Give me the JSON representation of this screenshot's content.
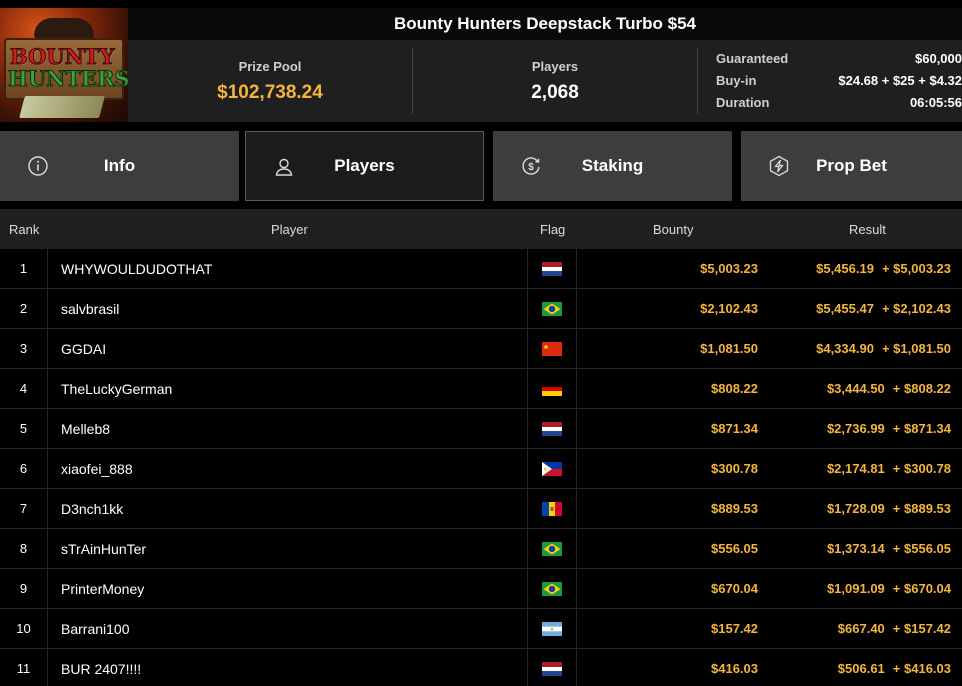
{
  "tournament": {
    "title": "Bounty Hunters Deepstack Turbo $54",
    "logo_text_line1": "BOUNTY",
    "logo_text_line2": "HUNTERS"
  },
  "stats": {
    "prize_pool_label": "Prize Pool",
    "prize_pool_value": "$102,738.24",
    "players_label": "Players",
    "players_value": "2,068",
    "guaranteed_label": "Guaranteed",
    "guaranteed_value": "$60,000",
    "buyin_label": "Buy-in",
    "buyin_value": "$24.68 + $25 + $4.32",
    "duration_label": "Duration",
    "duration_value": "06:05:56"
  },
  "tabs": [
    {
      "label": "Info",
      "icon": "info-icon"
    },
    {
      "label": "Players",
      "icon": "user-icon",
      "active": true
    },
    {
      "label": "Staking",
      "icon": "dollar-cycle-icon"
    },
    {
      "label": "Prop Bet",
      "icon": "lightning-icon"
    }
  ],
  "table": {
    "headers": {
      "rank": "Rank",
      "player": "Player",
      "flag": "Flag",
      "bounty": "Bounty",
      "result": "Result"
    },
    "rows": [
      {
        "rank": "1",
        "player": "WHYWOULDUDOTHAT",
        "flag": "nl",
        "bounty": "$5,003.23",
        "result": "$5,456.19",
        "result_bounty": "+ $5,003.23"
      },
      {
        "rank": "2",
        "player": "salvbrasil",
        "flag": "br",
        "bounty": "$2,102.43",
        "result": "$5,455.47",
        "result_bounty": "+ $2,102.43"
      },
      {
        "rank": "3",
        "player": "GGDAI",
        "flag": "cn",
        "bounty": "$1,081.50",
        "result": "$4,334.90",
        "result_bounty": "+ $1,081.50"
      },
      {
        "rank": "4",
        "player": "TheLuckyGerman",
        "flag": "de",
        "bounty": "$808.22",
        "result": "$3,444.50",
        "result_bounty": "+ $808.22"
      },
      {
        "rank": "5",
        "player": "Melleb8",
        "flag": "nl",
        "bounty": "$871.34",
        "result": "$2,736.99",
        "result_bounty": "+ $871.34"
      },
      {
        "rank": "6",
        "player": "xiaofei_888",
        "flag": "ph",
        "bounty": "$300.78",
        "result": "$2,174.81",
        "result_bounty": "+ $300.78"
      },
      {
        "rank": "7",
        "player": "D3nch1kk",
        "flag": "md",
        "bounty": "$889.53",
        "result": "$1,728.09",
        "result_bounty": "+ $889.53"
      },
      {
        "rank": "8",
        "player": "sTrAinHunTer",
        "flag": "br",
        "bounty": "$556.05",
        "result": "$1,373.14",
        "result_bounty": "+ $556.05"
      },
      {
        "rank": "9",
        "player": "PrinterMoney",
        "flag": "br",
        "bounty": "$670.04",
        "result": "$1,091.09",
        "result_bounty": "+ $670.04"
      },
      {
        "rank": "10",
        "player": "Barrani100",
        "flag": "ar",
        "bounty": "$157.42",
        "result": "$667.40",
        "result_bounty": "+ $157.42"
      },
      {
        "rank": "11",
        "player": "BUR 2407!!!!",
        "flag": "nl",
        "bounty": "$416.03",
        "result": "$506.61",
        "result_bounty": "+ $416.03"
      }
    ]
  },
  "colors": {
    "accent_gold": "#f3b53f",
    "background": "#000000",
    "tab_bg": "#3d3d3d",
    "header_bg": "#202020"
  }
}
